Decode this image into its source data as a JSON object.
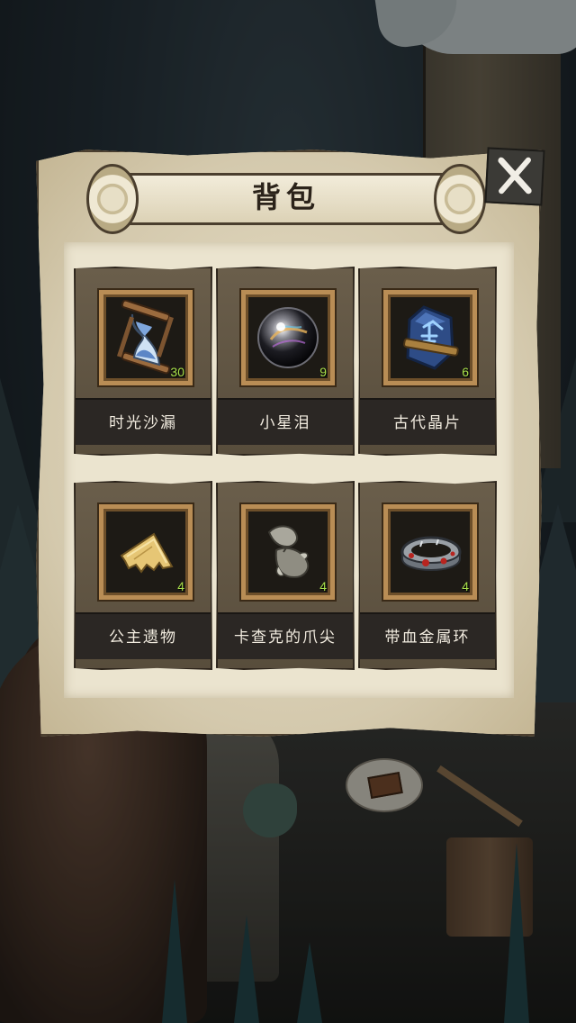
{
  "panel": {
    "title": "背包"
  },
  "items": [
    {
      "name": "时光沙漏",
      "count": "30",
      "icon": "hourglass-icon"
    },
    {
      "name": "小星泪",
      "count": "9",
      "icon": "star-tear-orb-icon"
    },
    {
      "name": "古代晶片",
      "count": "6",
      "icon": "ancient-crystal-chip-icon"
    },
    {
      "name": "公主遗物",
      "count": "4",
      "icon": "princess-relic-scrap-icon"
    },
    {
      "name": "卡查克的爪尖",
      "count": "4",
      "icon": "kachak-claw-tip-icon"
    },
    {
      "name": "带血金属环",
      "count": "4",
      "icon": "bloody-metal-ring-icon"
    }
  ],
  "close_button": {
    "icon": "close-x-icon"
  }
}
